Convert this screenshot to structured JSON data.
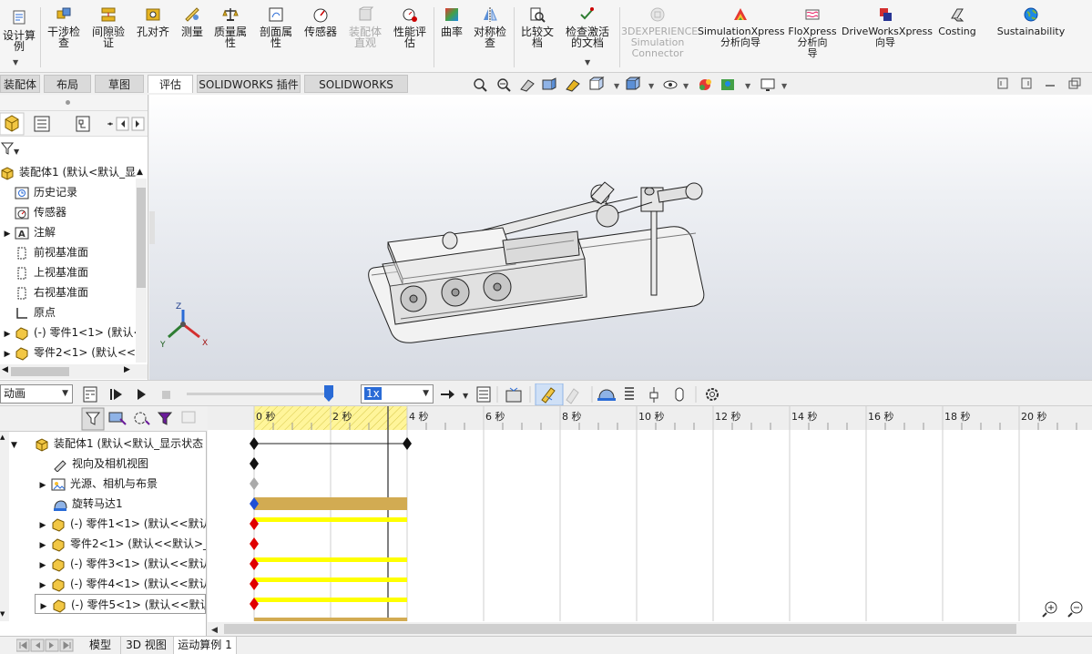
{
  "ribbon": {
    "items": [
      {
        "label": "设计算\n例"
      },
      {
        "label": "干涉检\n查"
      },
      {
        "label": "间隙验\n证"
      },
      {
        "label": "孔对齐"
      },
      {
        "label": "测量"
      },
      {
        "label": "质量属\n性"
      },
      {
        "label": "剖面属\n性"
      },
      {
        "label": "传感器"
      },
      {
        "label": "装配体\n直观"
      },
      {
        "label": "性能评\n估"
      },
      {
        "label": "曲率"
      },
      {
        "label": "对称检\n查"
      },
      {
        "label": "比较文\n档"
      },
      {
        "label": "检查激活\n的文档"
      },
      {
        "label": "3DEXPERIENCE\nSimulation\nConnector"
      },
      {
        "label": "SimulationXpress\n分析向导"
      },
      {
        "label": "FloXpress\n分析向\n导"
      },
      {
        "label": "DriveWorksXpress\n向导"
      },
      {
        "label": "Costing"
      },
      {
        "label": "Sustainability"
      }
    ]
  },
  "tabs": [
    "装配体",
    "布局",
    "草图",
    "评估",
    "SOLIDWORKS 插件",
    "SOLIDWORKS MBD"
  ],
  "feature_tree": {
    "root": "装配体1 (默认<默认_显示",
    "items": [
      "历史记录",
      "传感器",
      "注解",
      "前视基准面",
      "上视基准面",
      "右视基准面",
      "原点",
      "(-) 零件1<1> (默认<",
      "零件2<1> (默认<<默"
    ]
  },
  "triad": {
    "z": "Z",
    "y": "Y",
    "x": "X"
  },
  "motion": {
    "study_type": "动画",
    "speed": "1x"
  },
  "motion_tree": {
    "items": [
      "装配体1 (默认<默认_显示状态",
      "视向及相机视图",
      "光源、相机与布景",
      "旋转马达1",
      "(-) 零件1<1> (默认<<默认",
      "零件2<1> (默认<<默认>_",
      "(-) 零件3<1> (默认<<默认",
      "(-) 零件4<1> (默认<<默认",
      "(-) 零件5<1> (默认<<默认"
    ]
  },
  "timeline": {
    "ticks": [
      "0 秒",
      "2 秒",
      "4 秒",
      "6 秒",
      "8 秒",
      "10 秒",
      "12 秒",
      "14 秒",
      "16 秒",
      "18 秒",
      "20 秒"
    ]
  },
  "bottom_tabs": [
    "模型",
    "3D 视图",
    "运动算例 1"
  ],
  "colors": {
    "accent": "#2a6bd6",
    "timeline_highlight": "#fff59a",
    "motor_bar": "#d2ab52",
    "part_bar": "#ffff00"
  }
}
